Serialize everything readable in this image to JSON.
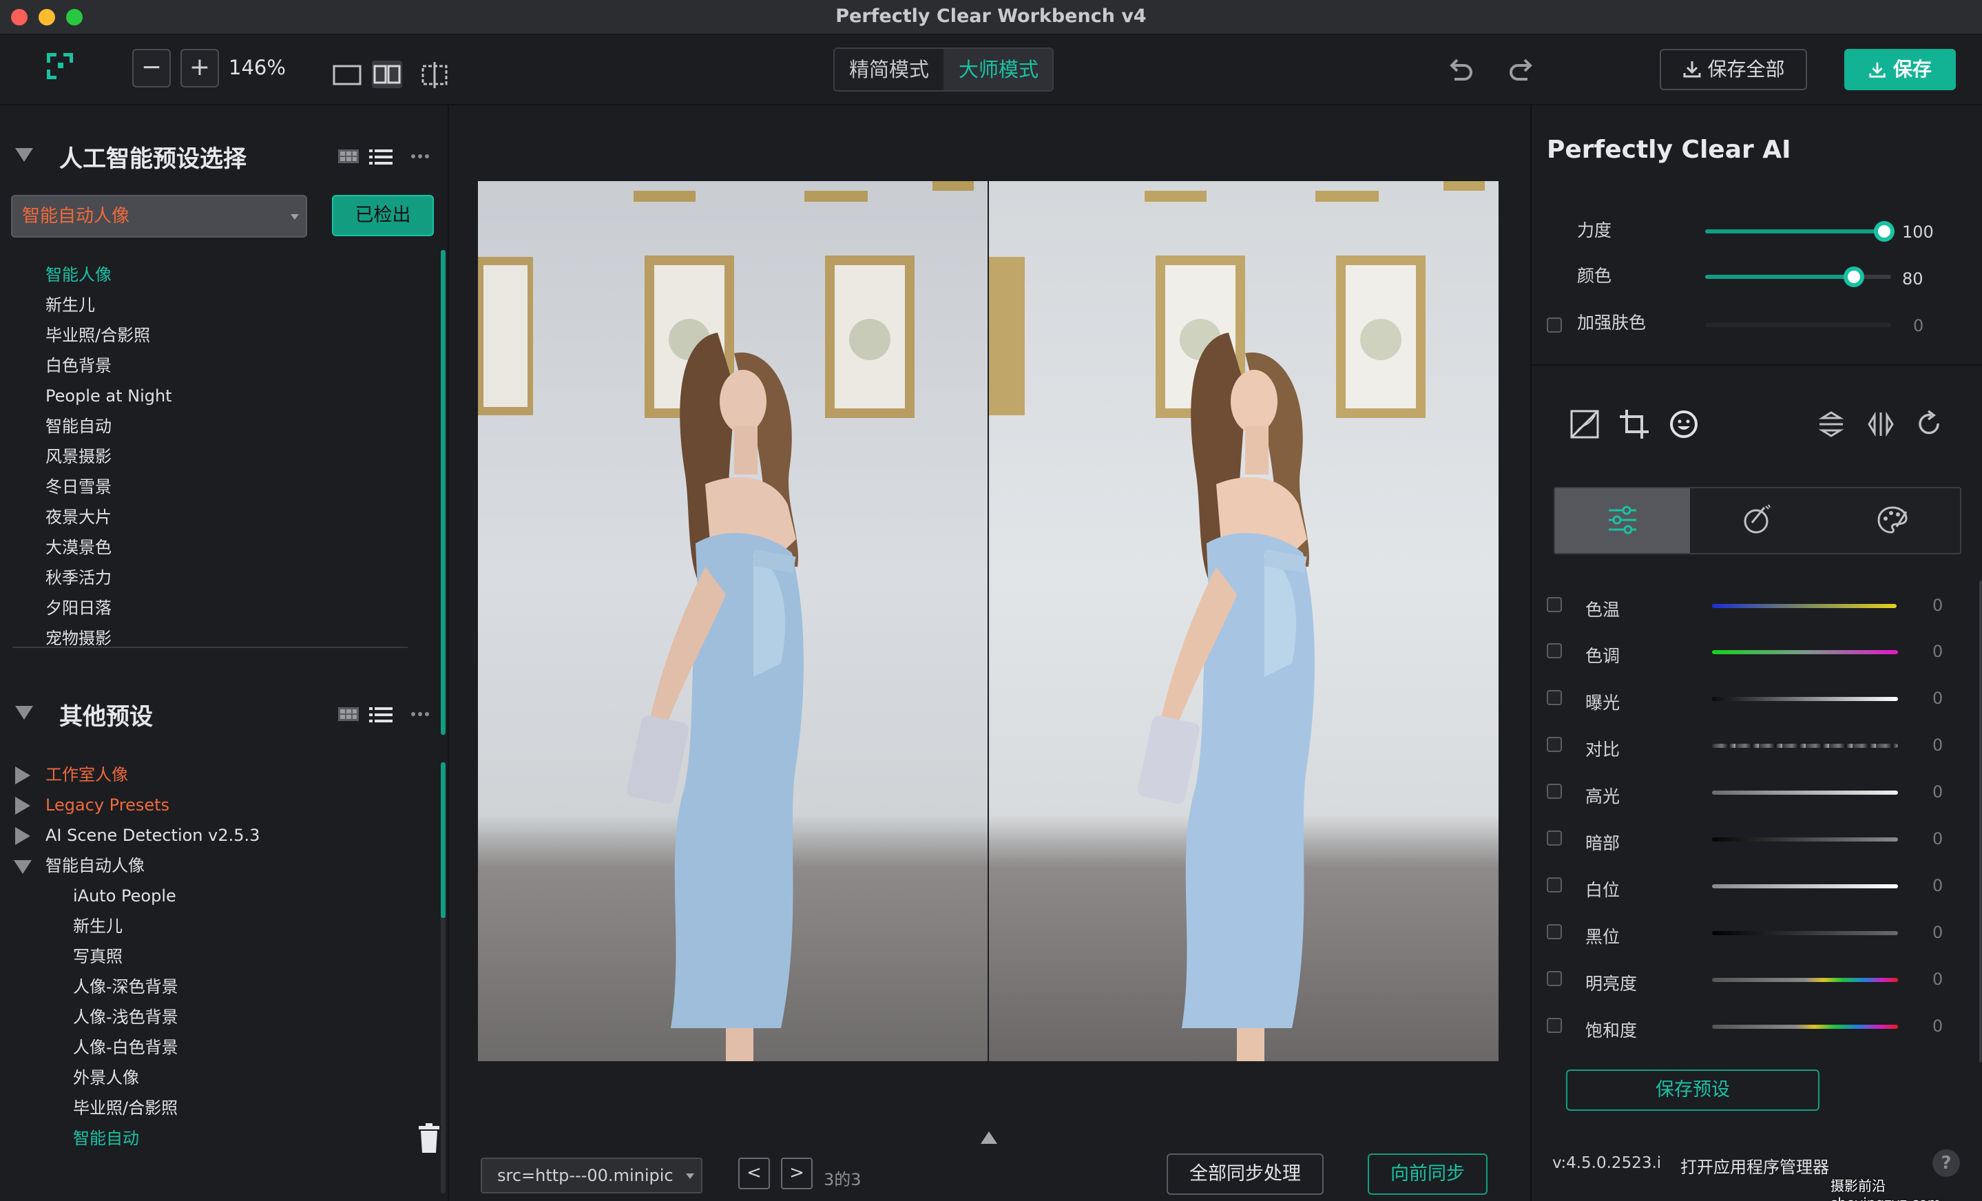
{
  "window": {
    "title": "Perfectly Clear Workbench v4"
  },
  "toolbar": {
    "zoom_out": "−",
    "zoom_in": "+",
    "zoom_level": "146%",
    "mode_simple": "精简模式",
    "mode_master": "大师模式",
    "save_all": "保存全部",
    "save": "保存"
  },
  "left": {
    "ai_section": {
      "title": "人工智能预设选择",
      "dropdown_value": "智能自动人像",
      "detected_button": "已检出",
      "items": [
        {
          "label": "智能人像",
          "active": true
        },
        {
          "label": "新生儿"
        },
        {
          "label": "毕业照/合影照"
        },
        {
          "label": "白色背景"
        },
        {
          "label": "People at Night"
        },
        {
          "label": "智能自动"
        },
        {
          "label": "风景摄影"
        },
        {
          "label": "冬日雪景"
        },
        {
          "label": "夜景大片"
        },
        {
          "label": "大漠景色"
        },
        {
          "label": "秋季活力"
        },
        {
          "label": "夕阳日落"
        },
        {
          "label": "宠物摄影"
        }
      ]
    },
    "other_section": {
      "title": "其他预设",
      "groups": [
        {
          "label": "工作室人像",
          "color": "orange"
        },
        {
          "label": "Legacy Presets",
          "color": "orange"
        },
        {
          "label": "AI Scene Detection v2.5.3"
        },
        {
          "label": "智能自动人像",
          "expanded": true
        }
      ],
      "sub_items": [
        {
          "label": "iAuto People"
        },
        {
          "label": "新生儿"
        },
        {
          "label": "写真照"
        },
        {
          "label": "人像-深色背景"
        },
        {
          "label": "人像-浅色背景"
        },
        {
          "label": "人像-白色背景"
        },
        {
          "label": "外景人像"
        },
        {
          "label": "毕业照/合影照"
        },
        {
          "label": "智能自动",
          "active": true
        }
      ]
    }
  },
  "canvas": {
    "file_select": "src=http---00.minipic",
    "prev": "<",
    "next": ">",
    "page": "3的3",
    "sync_all": "全部同步处理",
    "sync_forward": "向前同步"
  },
  "right": {
    "title": "Perfectly Clear AI",
    "strength": {
      "label": "力度",
      "value": "100",
      "level": 1.0
    },
    "color": {
      "label": "颜色",
      "value": "80",
      "level": 0.8
    },
    "skin": {
      "label": "加强肤色",
      "value": "0",
      "level": 0
    },
    "adjustments": [
      {
        "label": "色温",
        "value": "0"
      },
      {
        "label": "色调",
        "value": "0"
      },
      {
        "label": "曝光",
        "value": "0"
      },
      {
        "label": "对比",
        "value": "0"
      },
      {
        "label": "高光",
        "value": "0"
      },
      {
        "label": "暗部",
        "value": "0"
      },
      {
        "label": "白位",
        "value": "0"
      },
      {
        "label": "黑位",
        "value": "0"
      },
      {
        "label": "明亮度",
        "value": "0"
      },
      {
        "label": "饱和度",
        "value": "0"
      }
    ],
    "save_preset": "保存预设",
    "version": "v:4.5.0.2523.i",
    "app_manager": "打开应用程序管理器",
    "help": "?"
  },
  "watermark": "摄影前沿 sheyingzyz.com",
  "colors": {
    "accent": "#18c2a3",
    "accent_dark": "#129d81",
    "orange": "#ef6a3a",
    "panel": "#1c1d21"
  }
}
